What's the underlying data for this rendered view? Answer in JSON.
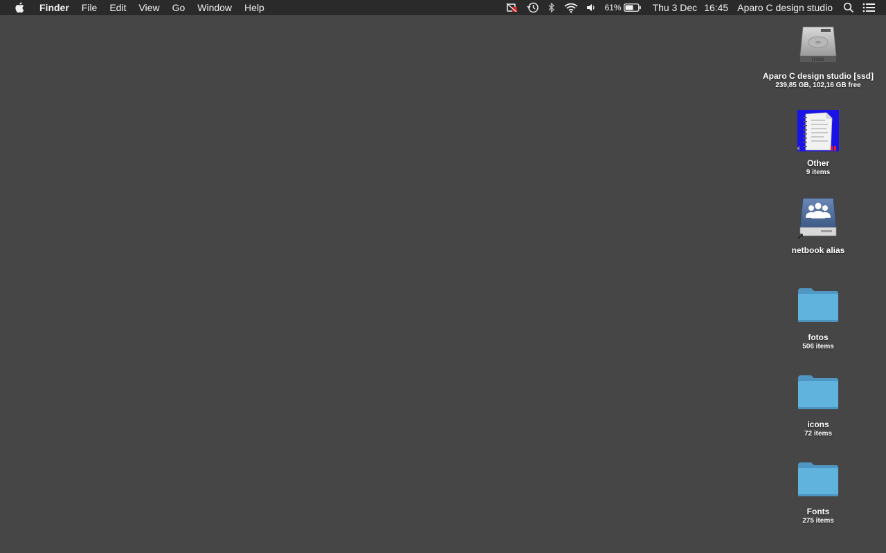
{
  "menubar": {
    "apple_icon": "apple-logo-icon",
    "app_name": "Finder",
    "menus": [
      "File",
      "Edit",
      "View",
      "Go",
      "Window",
      "Help"
    ],
    "status": {
      "battery_percent": "61%",
      "date": "Thu 3 Dec",
      "time": "16:45",
      "user": "Aparo C design studio"
    }
  },
  "desktop": {
    "items": [
      {
        "name": "Aparo C design studio [ssd]",
        "sub": "239,85 GB, 102,16 GB free",
        "icon": "hard-drive-icon"
      },
      {
        "name": "Other",
        "sub": "9 items",
        "icon": "document-folder-icon"
      },
      {
        "name": "netbook alias",
        "sub": "",
        "icon": "network-share-alias-icon"
      },
      {
        "name": "fotos",
        "sub": "506 items",
        "icon": "folder-icon"
      },
      {
        "name": "icons",
        "sub": "72 items",
        "icon": "folder-icon"
      },
      {
        "name": "Fonts",
        "sub": "275 items",
        "icon": "folder-icon"
      }
    ]
  },
  "colors": {
    "desktop_bg": "#464646",
    "menubar_bg": "#2a2a2a",
    "folder_blue": "#5fb3dd"
  }
}
